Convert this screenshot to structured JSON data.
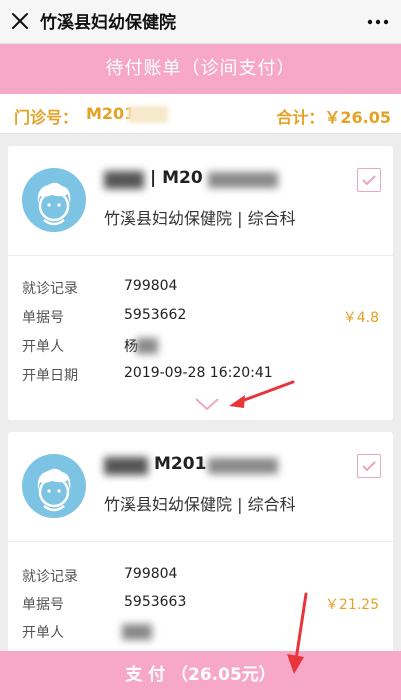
{
  "header": {
    "title": "竹溪县妇幼保健院",
    "close_icon": "close-icon",
    "more_icon": "more-icon"
  },
  "banner": {
    "title": "待付账单（诊间支付）"
  },
  "summary": {
    "clinic_label": "门诊号：",
    "clinic_value": "M201",
    "total": "合计：￥26.05"
  },
  "labels": {
    "record": "就诊记录",
    "receipt": "单据号",
    "issuer": "开单人",
    "date": "开单日期"
  },
  "bills": [
    {
      "patient_id": "| M20",
      "hospital": "竹溪县妇幼保健院 | 综合科",
      "record": "799804",
      "receipt": "5953662",
      "issuer": "杨",
      "date": "2019-09-28 16:20:41",
      "amount": "￥4.8"
    },
    {
      "patient_id": "M201",
      "hospital": "竹溪县妇幼保健院 | 综合科",
      "record": "799804",
      "receipt": "5953663",
      "amount": "￥21.25"
    }
  ],
  "pay": {
    "label": "支 付 （26.05元）"
  },
  "colors": {
    "accent": "#f7a8c8",
    "price": "#e4a224",
    "annotation_arrow": "#e8353a"
  }
}
